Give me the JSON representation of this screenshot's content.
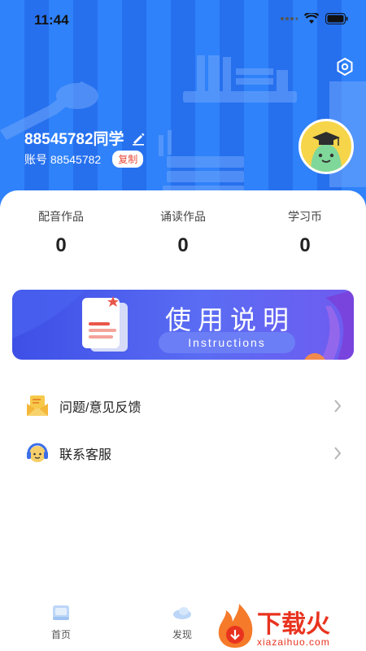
{
  "status_bar": {
    "time": "11:44"
  },
  "profile": {
    "username": "88545782同学",
    "account_label": "账号 88545782",
    "copy_label": "复制"
  },
  "stats": [
    {
      "label": "配音作品",
      "value": "0"
    },
    {
      "label": "诵读作品",
      "value": "0"
    },
    {
      "label": "学习币",
      "value": "0"
    }
  ],
  "banner": {
    "title": "使用说明",
    "subtitle": "Instructions"
  },
  "menu": [
    {
      "label": "问题/意见反馈",
      "icon": "envelope-icon"
    },
    {
      "label": "联系客服",
      "icon": "headset-icon"
    }
  ],
  "tabs": [
    {
      "label": "首页",
      "icon": "home-book-icon"
    },
    {
      "label": "发现",
      "icon": "discover-cloud-icon"
    }
  ],
  "watermark": {
    "text": "下载火",
    "url": "xiazaihuo.com"
  },
  "colors": {
    "header_blue": "#2b7cf7",
    "banner_blue": "#3d4fe6",
    "copy_red": "#e84a3b",
    "watermark_red": "#e8331f"
  }
}
